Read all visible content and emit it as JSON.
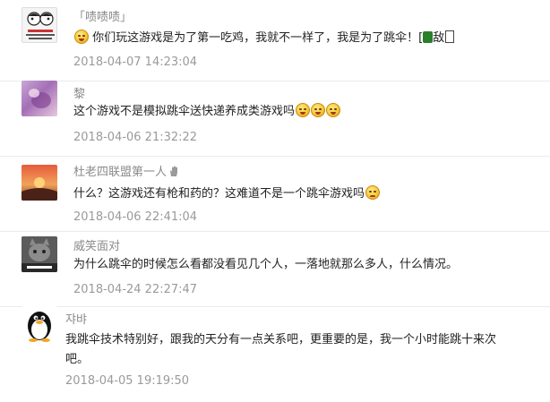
{
  "comments": [
    {
      "name": "「啧啧啧」",
      "text": "你们玩这游戏是为了第一吃鸡，我就不一样了，我是为了跳伞！[",
      "text_suffix": "敌",
      "time": "2018-04-07 14:23:04",
      "avatar_label": "吃鸡在\n你的穷在哪里出现"
    },
    {
      "name": "黎",
      "text": "这个游戏不是模拟跳伞送快递养成类游戏吗",
      "time": "2018-04-06 21:32:22"
    },
    {
      "name": "杜老四联盟第一人",
      "text": "什么？这游戏还有枪和药的？这难道不是一个跳伞游戏吗",
      "time": "2018-04-06 22:41:04"
    },
    {
      "name": "威笑面对",
      "text": "为什么跳伞的时候怎么看都没看见几个人，一落地就那么多人，什么情况。",
      "time": "2018-04-24 22:27:47",
      "avatar_label": "你不能这样"
    },
    {
      "name": "쟈뱌",
      "text": "我跳伞技术特别好，跟我的天分有一点关系吧，更重要的是，我一个小时能跳十来次\n吧。",
      "time": "2018-04-05 19:19:50"
    }
  ],
  "colors": {
    "name": "#8a8a8a",
    "text": "#222222",
    "time": "#9a9a9a",
    "divider": "#ebebeb"
  },
  "icons": [
    "smile-emoji-icon",
    "angry-emoji-icon",
    "hand-wave-icon"
  ]
}
